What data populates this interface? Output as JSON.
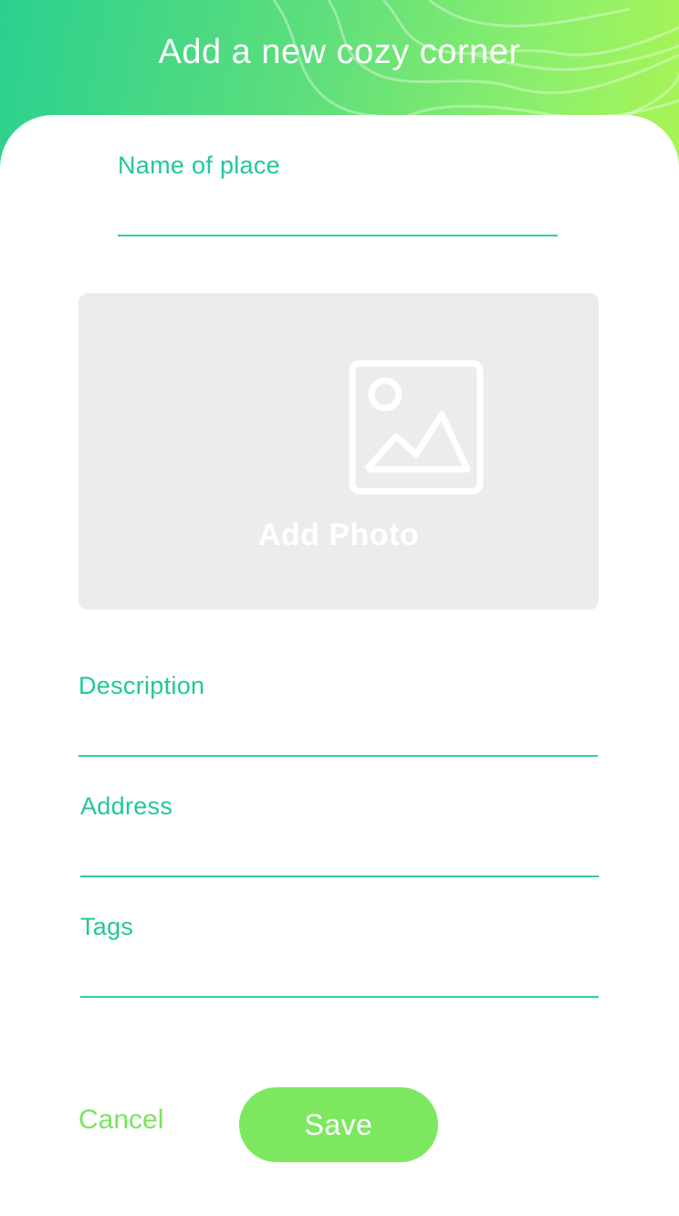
{
  "header": {
    "title": "Add a new cozy corner"
  },
  "form": {
    "name": {
      "label": "Name of place",
      "value": ""
    },
    "photo": {
      "label": "Add Photo",
      "icon": "image-icon"
    },
    "description": {
      "label": "Description",
      "value": ""
    },
    "address": {
      "label": "Address",
      "value": ""
    },
    "tags": {
      "label": "Tags",
      "value": ""
    }
  },
  "actions": {
    "cancel_label": "Cancel",
    "save_label": "Save"
  },
  "colors": {
    "accent_teal": "#22c79a",
    "accent_green": "#7de85f",
    "gradient_start": "#2bd08f",
    "gradient_end": "#a8f455",
    "photo_bg": "#ececec"
  }
}
